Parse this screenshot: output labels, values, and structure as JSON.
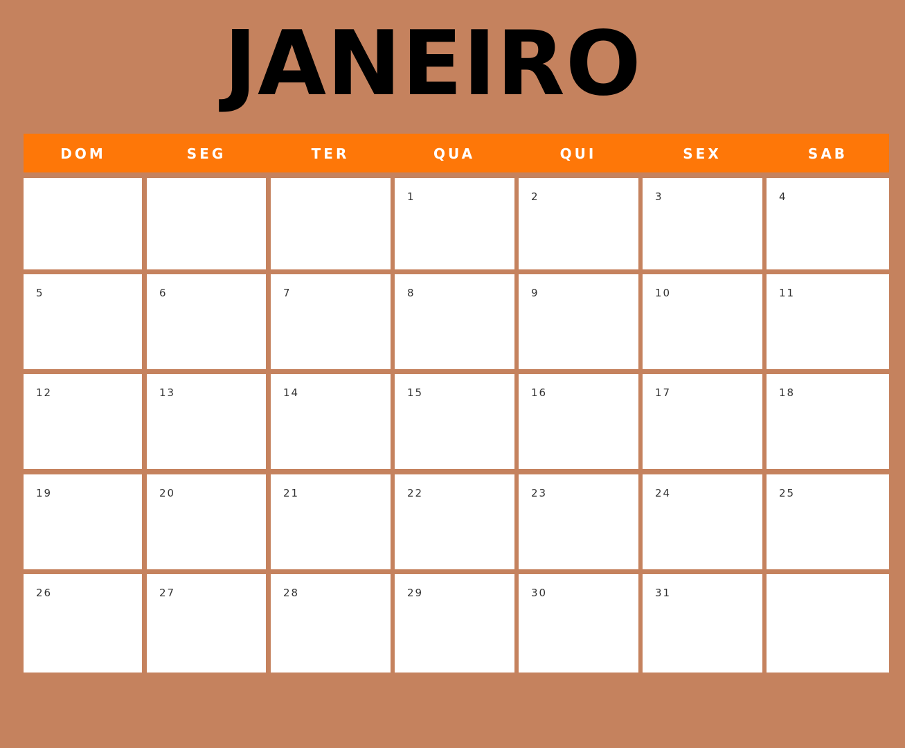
{
  "month_title": "JANEIRO",
  "colors": {
    "background": "#c5825e",
    "header_bar": "#fe7708",
    "cell": "#ffffff",
    "title": "#000000",
    "day_label": "#ffffff",
    "number": "#333333"
  },
  "weekdays": [
    "DOM",
    "SEG",
    "TER",
    "QUA",
    "QUI",
    "SEX",
    "SAB"
  ],
  "weeks": [
    [
      "",
      "",
      "",
      "1",
      "2",
      "3",
      "4"
    ],
    [
      "5",
      "6",
      "7",
      "8",
      "9",
      "10",
      "11"
    ],
    [
      "12",
      "13",
      "14",
      "15",
      "16",
      "17",
      "18"
    ],
    [
      "19",
      "20",
      "21",
      "22",
      "23",
      "24",
      "25"
    ],
    [
      "26",
      "27",
      "28",
      "29",
      "30",
      "31",
      ""
    ]
  ]
}
